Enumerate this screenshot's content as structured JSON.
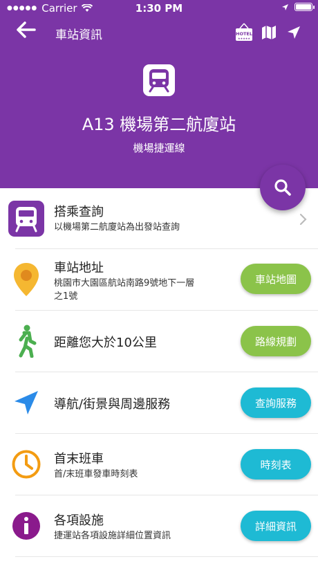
{
  "status_bar": {
    "carrier": "Carrier",
    "time": "1:30 PM"
  },
  "nav": {
    "title": "車站資訊"
  },
  "station": {
    "name": "A13 機場第二航廈站",
    "line": "機場捷運線"
  },
  "colors": {
    "purple": "#7b35a6",
    "green": "#8bc34a",
    "cyan": "#1ebad4",
    "yellow": "#f5b731",
    "orange": "#f39c12",
    "blue": "#2b8be8",
    "walk_green": "#4caf50",
    "info_purple": "#8a1a8c"
  },
  "rows": [
    {
      "title": "搭乘查詢",
      "subtitle": "以機場第二航廈站為出發站查詢",
      "icon": "train-icon"
    },
    {
      "title": "車站地址",
      "subtitle_line1": "桃園市大園區航站南路9號地下一層",
      "subtitle_line2": "之1號",
      "button": "車站地圖",
      "icon": "location-pin-icon"
    },
    {
      "title": "距離您大於10公里",
      "button": "路線規劃",
      "icon": "walking-person-icon"
    },
    {
      "title": "導航/街景與周邊服務",
      "button": "查詢服務",
      "icon": "navigation-arrow-icon"
    },
    {
      "title": "首末班車",
      "subtitle": "首/末班車發車時刻表",
      "button": "時刻表",
      "icon": "clock-icon"
    },
    {
      "title": "各項設施",
      "subtitle": "捷運站各項設施詳細位置資訊",
      "button": "詳細資訊",
      "icon": "info-icon"
    }
  ],
  "hotel_icon_text": "HOTEL"
}
